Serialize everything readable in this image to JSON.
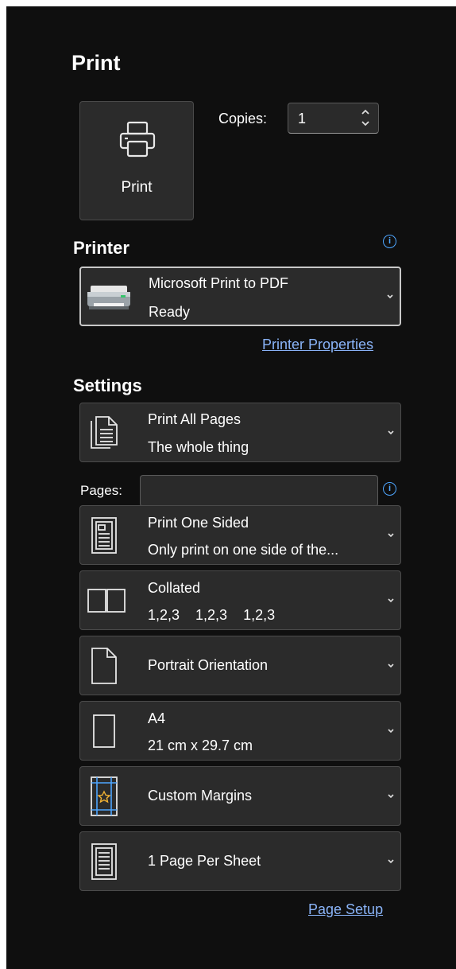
{
  "title": "Print",
  "print_button": {
    "label": "Print"
  },
  "copies": {
    "label": "Copies:",
    "value": "1"
  },
  "printer_section": {
    "heading": "Printer",
    "selected": {
      "name": "Microsoft Print to PDF",
      "status": "Ready"
    },
    "properties_link": "Printer Properties"
  },
  "settings_section": {
    "heading": "Settings",
    "pages_label": "Pages:",
    "pages_value": "",
    "items": [
      {
        "title": "Print All Pages",
        "subtitle": "The whole thing",
        "icon": "document-pages-icon"
      },
      {
        "title": "Print One Sided",
        "subtitle": "Only print on one side of the...",
        "icon": "one-sided-icon"
      },
      {
        "title": "Collated",
        "subtitle": "1,2,3    1,2,3    1,2,3",
        "icon": "collated-icon"
      },
      {
        "title": "Portrait Orientation",
        "subtitle": "",
        "icon": "portrait-icon"
      },
      {
        "title": "A4",
        "subtitle": "21 cm x 29.7 cm",
        "icon": "paper-size-icon"
      },
      {
        "title": "Custom Margins",
        "subtitle": "",
        "icon": "margins-icon"
      },
      {
        "title": "1 Page Per Sheet",
        "subtitle": "",
        "icon": "pages-per-sheet-icon"
      }
    ],
    "page_setup_link": "Page Setup"
  },
  "colors": {
    "background": "#0f0f0f",
    "control": "#2b2b2b",
    "accent": "#4ea6ff",
    "link": "#8ab4f8"
  }
}
